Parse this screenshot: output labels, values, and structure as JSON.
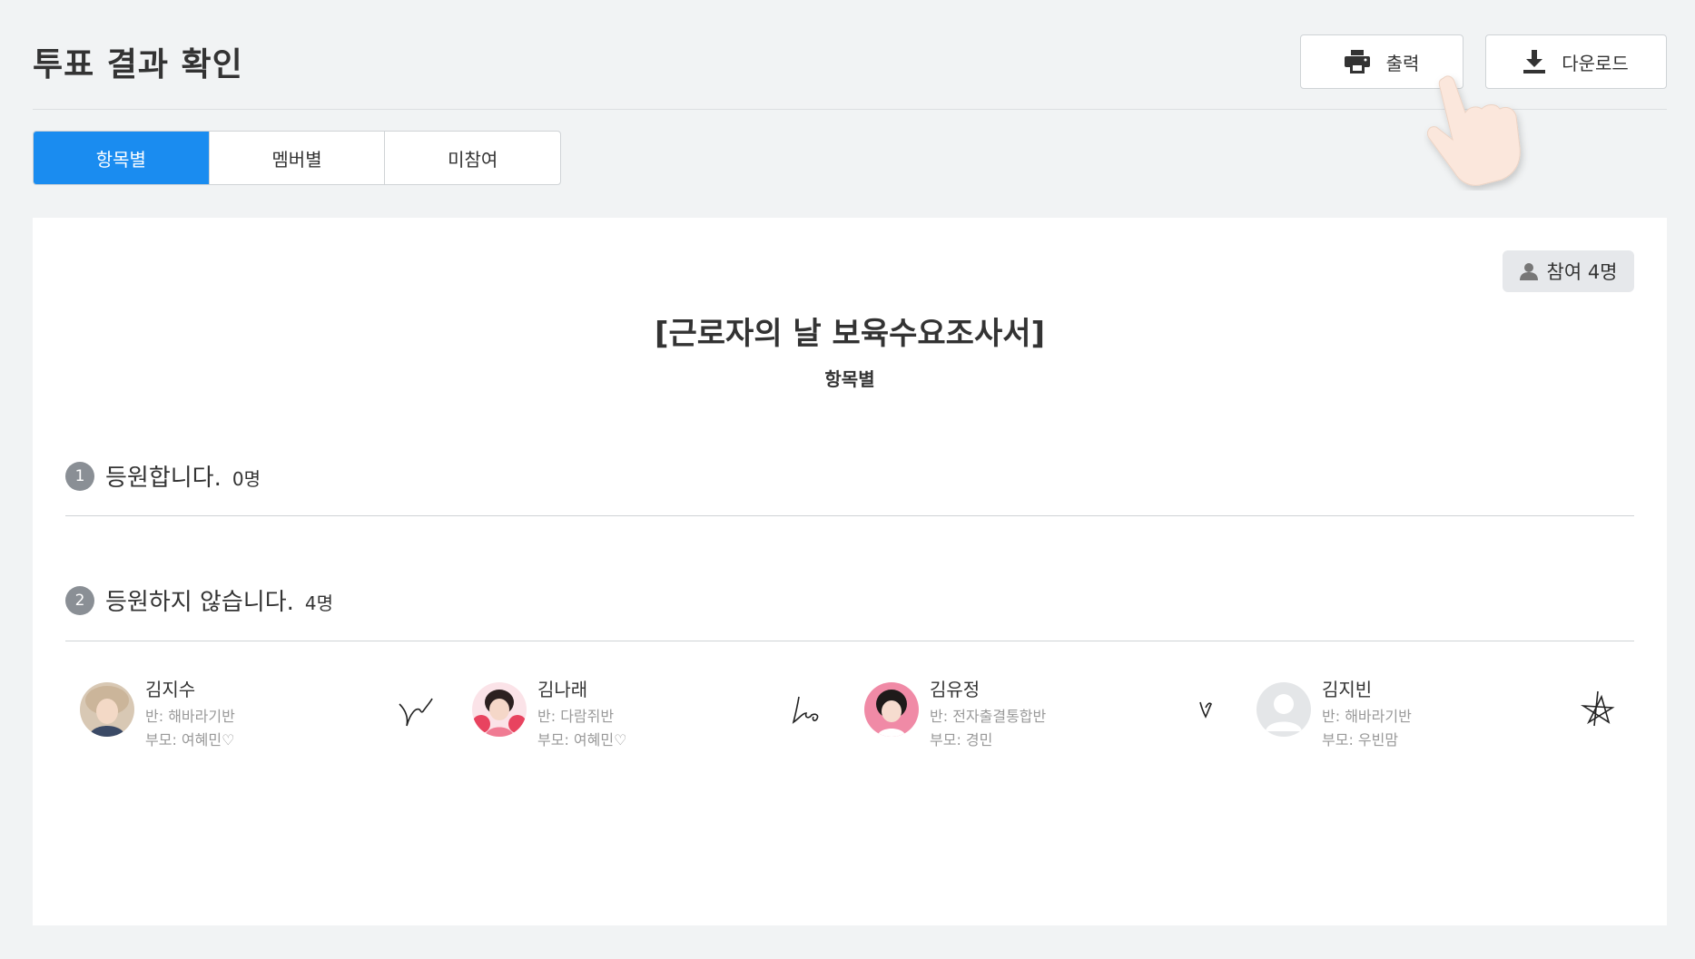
{
  "header": {
    "title": "투표 결과 확인",
    "print_label": "출력",
    "download_label": "다운로드"
  },
  "tabs": [
    {
      "label": "항목별",
      "active": true
    },
    {
      "label": "멤버별",
      "active": false
    },
    {
      "label": "미참여",
      "active": false
    }
  ],
  "card": {
    "participants": "참여 4명",
    "survey_title": "[근로자의 날 보육수요조사서]",
    "survey_subtitle": "항목별"
  },
  "items": [
    {
      "number": "1",
      "label": "등원합니다.",
      "count": "0명"
    },
    {
      "number": "2",
      "label": "등원하지 않습니다.",
      "count": "4명"
    }
  ],
  "members": [
    {
      "name": "김지수",
      "class": "반: 해바라기반",
      "parent": "부모: 여혜민♡",
      "avatar": "photo-girl-beige-hat"
    },
    {
      "name": "김나래",
      "class": "반: 다람쥐반",
      "parent": "부모: 여혜민♡",
      "avatar": "photo-girl-pink"
    },
    {
      "name": "김유정",
      "class": "반: 전자출결통합반",
      "parent": "부모: 경민",
      "avatar": "photo-child-pink-bg"
    },
    {
      "name": "김지빈",
      "class": "반: 해바라기반",
      "parent": "부모: 우빈맘",
      "avatar": "default-avatar"
    }
  ],
  "colors": {
    "accent": "#1a8cf0",
    "background": "#f1f3f4",
    "badge_bg": "#e6e8eb",
    "number_circle": "#8a8f95"
  }
}
